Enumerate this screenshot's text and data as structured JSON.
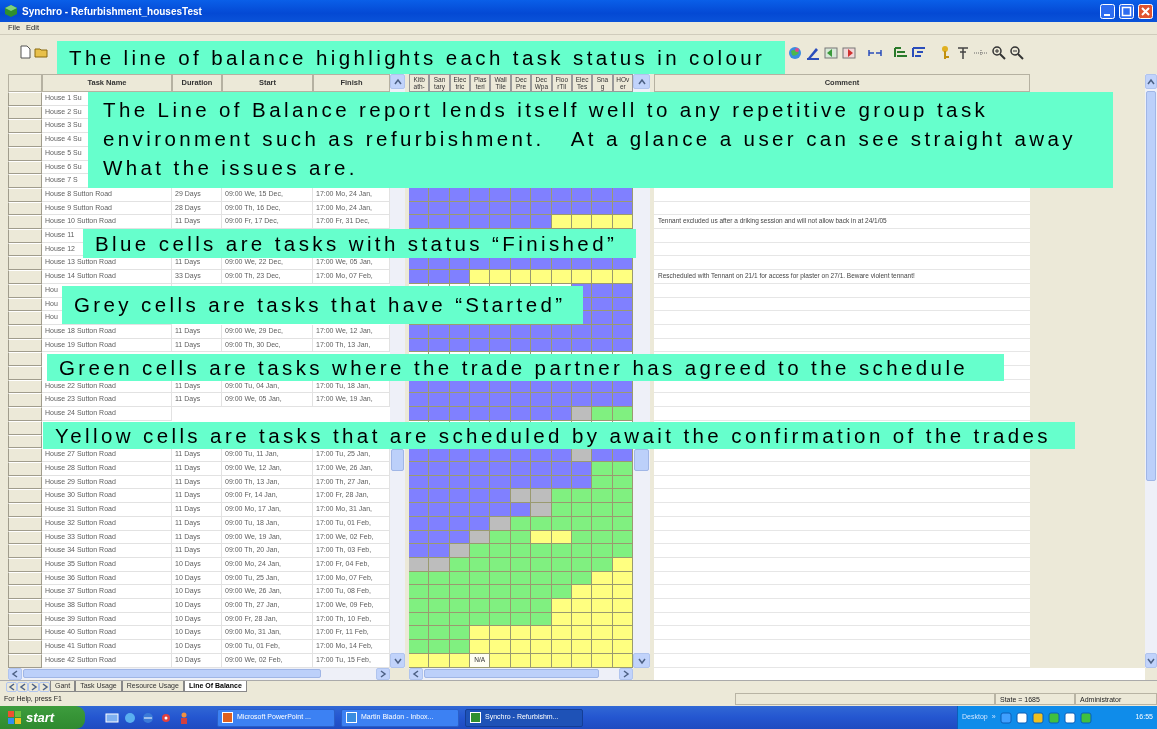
{
  "window": {
    "title": "Synchro - Refurbishment_housesTest"
  },
  "menu": [
    "File",
    "Edit"
  ],
  "columns": {
    "left": [
      "Task Name",
      "Duration",
      "Start",
      "Finish"
    ],
    "comment": "Comment"
  },
  "trades": [
    {
      "lines": [
        "Kitb",
        "ath-"
      ]
    },
    {
      "lines": [
        "San",
        "tary"
      ]
    },
    {
      "lines": [
        "Elec",
        "tric"
      ]
    },
    {
      "lines": [
        "Plas",
        "teri"
      ]
    },
    {
      "lines": [
        "Wall",
        "Tile"
      ]
    },
    {
      "lines": [
        "Dec",
        "Pre"
      ]
    },
    {
      "lines": [
        "Dec",
        "Wpa"
      ]
    },
    {
      "lines": [
        "Floo",
        "rTil"
      ]
    },
    {
      "lines": [
        "Elec",
        "Tes"
      ]
    },
    {
      "lines": [
        "Sna",
        "g"
      ]
    },
    {
      "lines": [
        "HOv",
        "er"
      ]
    }
  ],
  "rows": [
    {
      "task": "House 1 Su"
    },
    {
      "task": "House 2 Su"
    },
    {
      "task": "House 3 Su"
    },
    {
      "task": "House 4 Su"
    },
    {
      "task": "House 5 Su"
    },
    {
      "task": "House 6 Su"
    },
    {
      "task": "House 7 S"
    },
    {
      "task": "House 8 Sutton Road",
      "duration": "29 Days",
      "start": "09:00 We, 15 Dec,",
      "finish": "17:00 Mo, 24 Jan,",
      "cells": [
        {
          "kind": "done"
        },
        {
          "kind": "done"
        },
        {
          "kind": "done"
        },
        {
          "kind": "done"
        },
        {
          "kind": "done"
        },
        {
          "kind": "done"
        },
        {
          "kind": "done"
        },
        {
          "kind": "done"
        },
        {
          "kind": "done"
        },
        {
          "kind": "done"
        },
        {
          "kind": "done"
        }
      ]
    },
    {
      "task": "House 9 Sutton Road",
      "duration": "28 Days",
      "start": "09:00 Th, 16 Dec,",
      "finish": "17:00 Mo, 24 Jan,",
      "cells": [
        {
          "kind": "done"
        },
        {
          "kind": "done"
        },
        {
          "kind": "done"
        },
        {
          "kind": "done"
        },
        {
          "kind": "done"
        },
        {
          "kind": "done"
        },
        {
          "kind": "done"
        },
        {
          "kind": "done"
        },
        {
          "kind": "done"
        },
        {
          "kind": "done"
        },
        {
          "kind": "done"
        }
      ]
    },
    {
      "task": "House 10 Sutton Road",
      "duration": "11 Days",
      "start": "09:00 Fr, 17 Dec,",
      "finish": "17:00 Fr, 31 Dec,",
      "comment": "Tennant excluded us after a driking session and will not allow back in at 24/1/05",
      "cells": [
        {
          "kind": "done"
        },
        {
          "kind": "done"
        },
        {
          "kind": "done"
        },
        {
          "kind": "done"
        },
        {
          "kind": "done"
        },
        {
          "kind": "done"
        },
        {
          "kind": "done"
        },
        {
          "kind": "waiting"
        },
        {
          "kind": "waiting"
        },
        {
          "kind": "waiting"
        },
        {
          "kind": "waiting"
        }
      ]
    },
    {
      "task": "House 11"
    },
    {
      "task": "House 12"
    },
    {
      "task": "House 13 Sutton Road",
      "duration": "11 Days",
      "start": "09:00 We, 22 Dec,",
      "finish": "17:00 We, 05 Jan,",
      "cells": [
        {
          "kind": "done"
        },
        {
          "kind": "done"
        },
        {
          "kind": "done"
        },
        {
          "kind": "done"
        },
        {
          "kind": "done"
        },
        {
          "kind": "done"
        },
        {
          "kind": "done"
        },
        {
          "kind": "done"
        },
        {
          "kind": "done"
        },
        {
          "kind": "done"
        },
        {
          "kind": "done"
        }
      ]
    },
    {
      "task": "House 14 Sutton Road",
      "duration": "33 Days",
      "start": "09:00 Th, 23 Dec,",
      "finish": "17:00 Mo, 07 Feb,",
      "comment": "Rescheduled with Tennant on 21/1 for access for plaster on 27/1. Beware violent tennant!",
      "cells": [
        {
          "kind": "done"
        },
        {
          "kind": "done"
        },
        {
          "kind": "done"
        },
        {
          "kind": "waiting"
        },
        {
          "kind": "waiting"
        },
        {
          "kind": "waiting"
        },
        {
          "kind": "waiting"
        },
        {
          "kind": "waiting"
        },
        {
          "kind": "waiting"
        },
        {
          "kind": "waiting"
        },
        {
          "kind": "waiting"
        }
      ]
    },
    {
      "task": "Hou",
      "cells": [
        null,
        null,
        null,
        null,
        null,
        null,
        null,
        null,
        {
          "kind": "done"
        },
        {
          "kind": "done"
        },
        {
          "kind": "done"
        }
      ]
    },
    {
      "task": "Hou",
      "cells": [
        null,
        null,
        null,
        null,
        null,
        null,
        null,
        null,
        {
          "kind": "done"
        },
        {
          "kind": "done"
        },
        {
          "kind": "done"
        }
      ]
    },
    {
      "task": "Hou",
      "cells": [
        null,
        null,
        null,
        null,
        null,
        null,
        null,
        null,
        {
          "kind": "done"
        },
        {
          "kind": "done"
        },
        {
          "kind": "done"
        }
      ]
    },
    {
      "task": "House 18 Sutton Road",
      "duration": "11 Days",
      "start": "09:00 We, 29 Dec,",
      "finish": "17:00 We, 12 Jan,",
      "cells": [
        {
          "kind": "done"
        },
        {
          "kind": "done"
        },
        {
          "kind": "done"
        },
        {
          "kind": "done"
        },
        {
          "kind": "done"
        },
        {
          "kind": "done"
        },
        {
          "kind": "done"
        },
        {
          "kind": "done"
        },
        {
          "kind": "done"
        },
        {
          "kind": "done"
        },
        {
          "kind": "done"
        }
      ]
    },
    {
      "task": "House 19 Sutton Road",
      "duration": "11 Days",
      "start": "09:00 Th, 30 Dec,",
      "finish": "17:00 Th, 13 Jan,",
      "cells": [
        {
          "kind": "done"
        },
        {
          "kind": "done"
        },
        {
          "kind": "done"
        },
        {
          "kind": "done"
        },
        {
          "kind": "done"
        },
        {
          "kind": "done"
        },
        {
          "kind": "done"
        },
        {
          "kind": "done"
        },
        {
          "kind": "done"
        },
        {
          "kind": "done"
        },
        {
          "kind": "done"
        }
      ]
    },
    {},
    {},
    {
      "task": "House 22 Sutton Road",
      "duration": "11 Days",
      "start": "09:00 Tu, 04 Jan,",
      "finish": "17:00 Tu, 18 Jan,",
      "cells": [
        {
          "kind": "done"
        },
        {
          "kind": "done"
        },
        {
          "kind": "done"
        },
        {
          "kind": "done"
        },
        {
          "kind": "done"
        },
        {
          "kind": "done"
        },
        {
          "kind": "done"
        },
        {
          "kind": "done"
        },
        {
          "kind": "done"
        },
        {
          "kind": "done"
        },
        {
          "kind": "done"
        }
      ]
    },
    {
      "task": "House 23 Sutton Road",
      "duration": "11 Days",
      "start": "09:00 We, 05 Jan,",
      "finish": "17:00 We, 19 Jan,",
      "cells": [
        {
          "kind": "done"
        },
        {
          "kind": "done"
        },
        {
          "kind": "done"
        },
        {
          "kind": "done"
        },
        {
          "kind": "done"
        },
        {
          "kind": "done"
        },
        {
          "kind": "done"
        },
        {
          "kind": "done"
        },
        {
          "kind": "done"
        },
        {
          "kind": "done"
        },
        {
          "kind": "done"
        }
      ]
    },
    {
      "task": "House 24 Sutton Road",
      "cells": [
        {
          "kind": "done"
        },
        {
          "kind": "done"
        },
        {
          "kind": "done"
        },
        {
          "kind": "done"
        },
        {
          "kind": "done"
        },
        {
          "kind": "done"
        },
        {
          "kind": "done"
        },
        {
          "kind": "done"
        },
        {
          "kind": "started"
        },
        {
          "kind": "agreed"
        },
        {
          "kind": "agreed"
        }
      ]
    },
    {},
    {},
    {
      "task": "House 27 Sutton Road",
      "duration": "11 Days",
      "start": "09:00 Tu, 11 Jan,",
      "finish": "17:00 Tu, 25 Jan,",
      "cells": [
        {
          "kind": "done"
        },
        {
          "kind": "done"
        },
        {
          "kind": "done"
        },
        {
          "kind": "done"
        },
        {
          "kind": "done"
        },
        {
          "kind": "done"
        },
        {
          "kind": "done"
        },
        {
          "kind": "done"
        },
        {
          "kind": "started"
        },
        {
          "kind": "done"
        },
        {
          "kind": "done"
        }
      ]
    },
    {
      "task": "House 28 Sutton Road",
      "duration": "11 Days",
      "start": "09:00 We, 12 Jan,",
      "finish": "17:00 We, 26 Jan,",
      "cells": [
        {
          "kind": "done"
        },
        {
          "kind": "done"
        },
        {
          "kind": "done"
        },
        {
          "kind": "done"
        },
        {
          "kind": "done"
        },
        {
          "kind": "done"
        },
        {
          "kind": "done"
        },
        {
          "kind": "done"
        },
        {
          "kind": "done"
        },
        {
          "kind": "agreed"
        },
        {
          "kind": "agreed"
        }
      ]
    },
    {
      "task": "House 29 Sutton Road",
      "duration": "11 Days",
      "start": "09:00 Th, 13 Jan,",
      "finish": "17:00 Th, 27 Jan,",
      "cells": [
        {
          "kind": "done"
        },
        {
          "kind": "done"
        },
        {
          "kind": "done"
        },
        {
          "kind": "done"
        },
        {
          "kind": "done"
        },
        {
          "kind": "done"
        },
        {
          "kind": "done"
        },
        {
          "kind": "done"
        },
        {
          "kind": "done"
        },
        {
          "kind": "agreed"
        },
        {
          "kind": "agreed"
        }
      ]
    },
    {
      "task": "House 30 Sutton Road",
      "duration": "11 Days",
      "start": "09:00 Fr, 14 Jan,",
      "finish": "17:00 Fr, 28 Jan,",
      "cells": [
        {
          "kind": "done"
        },
        {
          "kind": "done"
        },
        {
          "kind": "done"
        },
        {
          "kind": "done"
        },
        {
          "kind": "done"
        },
        {
          "kind": "started"
        },
        {
          "kind": "started"
        },
        {
          "kind": "agreed"
        },
        {
          "kind": "agreed"
        },
        {
          "kind": "agreed"
        },
        {
          "kind": "agreed"
        }
      ]
    },
    {
      "task": "House 31 Sutton Road",
      "duration": "11 Days",
      "start": "09:00 Mo, 17 Jan,",
      "finish": "17:00 Mo, 31 Jan,",
      "cells": [
        {
          "kind": "done"
        },
        {
          "kind": "done"
        },
        {
          "kind": "done"
        },
        {
          "kind": "done"
        },
        {
          "kind": "done"
        },
        {
          "kind": "done"
        },
        {
          "kind": "started"
        },
        {
          "kind": "agreed"
        },
        {
          "kind": "agreed"
        },
        {
          "kind": "agreed"
        },
        {
          "kind": "agreed"
        }
      ]
    },
    {
      "task": "House 32 Sutton Road",
      "duration": "11 Days",
      "start": "09:00 Tu, 18 Jan,",
      "finish": "17:00 Tu, 01 Feb,",
      "cells": [
        {
          "kind": "done"
        },
        {
          "kind": "done"
        },
        {
          "kind": "done"
        },
        {
          "kind": "done"
        },
        {
          "kind": "started"
        },
        {
          "kind": "agreed"
        },
        {
          "kind": "agreed"
        },
        {
          "kind": "agreed"
        },
        {
          "kind": "agreed"
        },
        {
          "kind": "agreed"
        },
        {
          "kind": "agreed"
        }
      ]
    },
    {
      "task": "House 33 Sutton Road",
      "duration": "11 Days",
      "start": "09:00 We, 19 Jan,",
      "finish": "17:00 We, 02 Feb,",
      "cells": [
        {
          "kind": "done"
        },
        {
          "kind": "done"
        },
        {
          "kind": "done"
        },
        {
          "kind": "started"
        },
        {
          "kind": "agreed"
        },
        {
          "kind": "agreed"
        },
        {
          "kind": "waiting"
        },
        {
          "kind": "waiting"
        },
        {
          "kind": "agreed"
        },
        {
          "kind": "agreed"
        },
        {
          "kind": "agreed"
        }
      ]
    },
    {
      "task": "House 34 Sutton Road",
      "duration": "11 Days",
      "start": "09:00 Th, 20 Jan,",
      "finish": "17:00 Th, 03 Feb,",
      "cells": [
        {
          "kind": "done"
        },
        {
          "kind": "done"
        },
        {
          "kind": "started"
        },
        {
          "kind": "agreed"
        },
        {
          "kind": "agreed"
        },
        {
          "kind": "agreed"
        },
        {
          "kind": "agreed"
        },
        {
          "kind": "agreed"
        },
        {
          "kind": "agreed"
        },
        {
          "kind": "agreed"
        },
        {
          "kind": "agreed"
        }
      ]
    },
    {
      "task": "House 35 Sutton Road",
      "duration": "10 Days",
      "start": "09:00 Mo, 24 Jan,",
      "finish": "17:00 Fr, 04 Feb,",
      "cells": [
        {
          "kind": "started"
        },
        {
          "kind": "started"
        },
        {
          "kind": "agreed"
        },
        {
          "kind": "agreed"
        },
        {
          "kind": "agreed"
        },
        {
          "kind": "agreed"
        },
        {
          "kind": "agreed"
        },
        {
          "kind": "agreed"
        },
        {
          "kind": "agreed"
        },
        {
          "kind": "agreed"
        },
        {
          "kind": "waiting"
        }
      ]
    },
    {
      "task": "House 36 Sutton Road",
      "duration": "10 Days",
      "start": "09:00 Tu, 25 Jan,",
      "finish": "17:00 Mo, 07 Feb,",
      "cells": [
        {
          "kind": "agreed"
        },
        {
          "kind": "agreed"
        },
        {
          "kind": "agreed"
        },
        {
          "kind": "agreed"
        },
        {
          "kind": "agreed"
        },
        {
          "kind": "agreed"
        },
        {
          "kind": "agreed"
        },
        {
          "kind": "agreed"
        },
        {
          "kind": "agreed"
        },
        {
          "kind": "waiting"
        },
        {
          "kind": "waiting"
        }
      ]
    },
    {
      "task": "House 37 Sutton Road",
      "duration": "10 Days",
      "start": "09:00 We, 26 Jan,",
      "finish": "17:00 Tu, 08 Feb,",
      "cells": [
        {
          "kind": "agreed"
        },
        {
          "kind": "agreed"
        },
        {
          "kind": "agreed"
        },
        {
          "kind": "agreed"
        },
        {
          "kind": "agreed"
        },
        {
          "kind": "agreed"
        },
        {
          "kind": "agreed"
        },
        {
          "kind": "agreed"
        },
        {
          "kind": "waiting"
        },
        {
          "kind": "waiting"
        },
        {
          "kind": "waiting"
        }
      ]
    },
    {
      "task": "House 38 Sutton Road",
      "duration": "10 Days",
      "start": "09:00 Th, 27 Jan,",
      "finish": "17:00 We, 09 Feb,",
      "cells": [
        {
          "kind": "agreed"
        },
        {
          "kind": "agreed"
        },
        {
          "kind": "agreed"
        },
        {
          "kind": "agreed"
        },
        {
          "kind": "agreed"
        },
        {
          "kind": "agreed"
        },
        {
          "kind": "agreed"
        },
        {
          "kind": "waiting"
        },
        {
          "kind": "waiting"
        },
        {
          "kind": "waiting"
        },
        {
          "kind": "waiting"
        }
      ]
    },
    {
      "task": "House 39 Sutton Road",
      "duration": "10 Days",
      "start": "09:00 Fr, 28 Jan,",
      "finish": "17:00 Th, 10 Feb,",
      "cells": [
        {
          "kind": "agreed"
        },
        {
          "kind": "agreed"
        },
        {
          "kind": "agreed"
        },
        {
          "kind": "agreed"
        },
        {
          "kind": "agreed"
        },
        {
          "kind": "agreed"
        },
        {
          "kind": "agreed"
        },
        {
          "kind": "waiting"
        },
        {
          "kind": "waiting"
        },
        {
          "kind": "waiting"
        },
        {
          "kind": "waiting"
        }
      ]
    },
    {
      "task": "House 40 Sutton Road",
      "duration": "10 Days",
      "start": "09:00 Mo, 31 Jan,",
      "finish": "17:00 Fr, 11 Feb,",
      "cells": [
        {
          "kind": "agreed"
        },
        {
          "kind": "agreed"
        },
        {
          "kind": "agreed"
        },
        {
          "kind": "waiting"
        },
        {
          "kind": "waiting"
        },
        {
          "kind": "waiting"
        },
        {
          "kind": "waiting"
        },
        {
          "kind": "waiting"
        },
        {
          "kind": "waiting"
        },
        {
          "kind": "waiting"
        },
        {
          "kind": "waiting"
        }
      ]
    },
    {
      "task": "House 41 Sutton Road",
      "duration": "10 Days",
      "start": "09:00 Tu, 01 Feb,",
      "finish": "17:00 Mo, 14 Feb,",
      "cells": [
        {
          "kind": "agreed"
        },
        {
          "kind": "agreed"
        },
        {
          "kind": "agreed"
        },
        {
          "kind": "waiting"
        },
        {
          "kind": "waiting"
        },
        {
          "kind": "waiting"
        },
        {
          "kind": "waiting"
        },
        {
          "kind": "waiting"
        },
        {
          "kind": "waiting"
        },
        {
          "kind": "waiting"
        },
        {
          "kind": "waiting"
        }
      ]
    },
    {
      "task": "House 42 Sutton Road",
      "duration": "10 Days",
      "start": "09:00 We, 02 Feb,",
      "finish": "17:00 Tu, 15 Feb,",
      "cells": [
        {
          "kind": "waiting"
        },
        {
          "kind": "waiting"
        },
        {
          "kind": "waiting"
        },
        {
          "kind": "label",
          "text": "N/A"
        },
        {
          "kind": "waiting"
        },
        {
          "kind": "waiting"
        },
        {
          "kind": "waiting"
        },
        {
          "kind": "waiting"
        },
        {
          "kind": "waiting"
        },
        {
          "kind": "waiting"
        },
        {
          "kind": "waiting"
        }
      ]
    }
  ],
  "sheet_tabs": [
    {
      "label": "Gant",
      "selected": false
    },
    {
      "label": "Task Usage",
      "selected": false
    },
    {
      "label": "Resource Usage",
      "selected": false
    },
    {
      "label": "Line Of Balance",
      "selected": true
    }
  ],
  "status_bar": {
    "help": "For Help, press F1",
    "state": "State = 1685",
    "user": "Administrator"
  },
  "taskbar": {
    "start": "start",
    "tasks": [
      {
        "label": "Microsoft PowerPoint ...",
        "selected": false
      },
      {
        "label": "Martin Bladon - Inbox...",
        "selected": false
      },
      {
        "label": "Synchro - Refurbishm...",
        "selected": true
      }
    ],
    "desktop": "Desktop",
    "chevron": "»",
    "clock": "16:55"
  },
  "callouts": [
    {
      "text": "The line of balance highlights each task status in colour"
    },
    {
      "text": "The Line of Balance report lends itself well to any repetitive group task\nenvironment such as refurbishment.   At a glance a user can see straight away\nWhat the issues are."
    },
    {
      "text": "Blue cells are tasks with status “Finished”"
    },
    {
      "text": "Grey cells are tasks that have “Started”"
    },
    {
      "text": "Green cells are tasks where the trade partner has agreed to the schedule"
    },
    {
      "text": "Yellow cells are tasks that are scheduled by await the confirmation of the trades"
    }
  ]
}
